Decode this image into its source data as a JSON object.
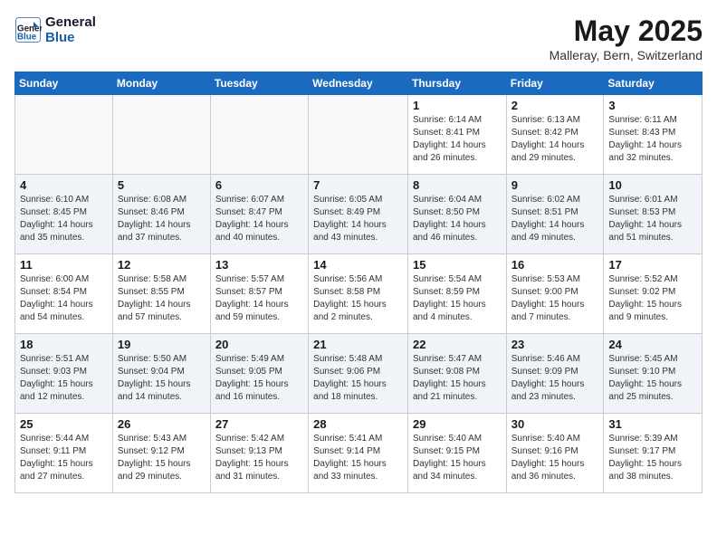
{
  "header": {
    "logo_line1": "General",
    "logo_line2": "Blue",
    "month": "May 2025",
    "location": "Malleray, Bern, Switzerland"
  },
  "weekdays": [
    "Sunday",
    "Monday",
    "Tuesday",
    "Wednesday",
    "Thursday",
    "Friday",
    "Saturday"
  ],
  "weeks": [
    [
      {
        "day": "",
        "info": ""
      },
      {
        "day": "",
        "info": ""
      },
      {
        "day": "",
        "info": ""
      },
      {
        "day": "",
        "info": ""
      },
      {
        "day": "1",
        "info": "Sunrise: 6:14 AM\nSunset: 8:41 PM\nDaylight: 14 hours\nand 26 minutes."
      },
      {
        "day": "2",
        "info": "Sunrise: 6:13 AM\nSunset: 8:42 PM\nDaylight: 14 hours\nand 29 minutes."
      },
      {
        "day": "3",
        "info": "Sunrise: 6:11 AM\nSunset: 8:43 PM\nDaylight: 14 hours\nand 32 minutes."
      }
    ],
    [
      {
        "day": "4",
        "info": "Sunrise: 6:10 AM\nSunset: 8:45 PM\nDaylight: 14 hours\nand 35 minutes."
      },
      {
        "day": "5",
        "info": "Sunrise: 6:08 AM\nSunset: 8:46 PM\nDaylight: 14 hours\nand 37 minutes."
      },
      {
        "day": "6",
        "info": "Sunrise: 6:07 AM\nSunset: 8:47 PM\nDaylight: 14 hours\nand 40 minutes."
      },
      {
        "day": "7",
        "info": "Sunrise: 6:05 AM\nSunset: 8:49 PM\nDaylight: 14 hours\nand 43 minutes."
      },
      {
        "day": "8",
        "info": "Sunrise: 6:04 AM\nSunset: 8:50 PM\nDaylight: 14 hours\nand 46 minutes."
      },
      {
        "day": "9",
        "info": "Sunrise: 6:02 AM\nSunset: 8:51 PM\nDaylight: 14 hours\nand 49 minutes."
      },
      {
        "day": "10",
        "info": "Sunrise: 6:01 AM\nSunset: 8:53 PM\nDaylight: 14 hours\nand 51 minutes."
      }
    ],
    [
      {
        "day": "11",
        "info": "Sunrise: 6:00 AM\nSunset: 8:54 PM\nDaylight: 14 hours\nand 54 minutes."
      },
      {
        "day": "12",
        "info": "Sunrise: 5:58 AM\nSunset: 8:55 PM\nDaylight: 14 hours\nand 57 minutes."
      },
      {
        "day": "13",
        "info": "Sunrise: 5:57 AM\nSunset: 8:57 PM\nDaylight: 14 hours\nand 59 minutes."
      },
      {
        "day": "14",
        "info": "Sunrise: 5:56 AM\nSunset: 8:58 PM\nDaylight: 15 hours\nand 2 minutes."
      },
      {
        "day": "15",
        "info": "Sunrise: 5:54 AM\nSunset: 8:59 PM\nDaylight: 15 hours\nand 4 minutes."
      },
      {
        "day": "16",
        "info": "Sunrise: 5:53 AM\nSunset: 9:00 PM\nDaylight: 15 hours\nand 7 minutes."
      },
      {
        "day": "17",
        "info": "Sunrise: 5:52 AM\nSunset: 9:02 PM\nDaylight: 15 hours\nand 9 minutes."
      }
    ],
    [
      {
        "day": "18",
        "info": "Sunrise: 5:51 AM\nSunset: 9:03 PM\nDaylight: 15 hours\nand 12 minutes."
      },
      {
        "day": "19",
        "info": "Sunrise: 5:50 AM\nSunset: 9:04 PM\nDaylight: 15 hours\nand 14 minutes."
      },
      {
        "day": "20",
        "info": "Sunrise: 5:49 AM\nSunset: 9:05 PM\nDaylight: 15 hours\nand 16 minutes."
      },
      {
        "day": "21",
        "info": "Sunrise: 5:48 AM\nSunset: 9:06 PM\nDaylight: 15 hours\nand 18 minutes."
      },
      {
        "day": "22",
        "info": "Sunrise: 5:47 AM\nSunset: 9:08 PM\nDaylight: 15 hours\nand 21 minutes."
      },
      {
        "day": "23",
        "info": "Sunrise: 5:46 AM\nSunset: 9:09 PM\nDaylight: 15 hours\nand 23 minutes."
      },
      {
        "day": "24",
        "info": "Sunrise: 5:45 AM\nSunset: 9:10 PM\nDaylight: 15 hours\nand 25 minutes."
      }
    ],
    [
      {
        "day": "25",
        "info": "Sunrise: 5:44 AM\nSunset: 9:11 PM\nDaylight: 15 hours\nand 27 minutes."
      },
      {
        "day": "26",
        "info": "Sunrise: 5:43 AM\nSunset: 9:12 PM\nDaylight: 15 hours\nand 29 minutes."
      },
      {
        "day": "27",
        "info": "Sunrise: 5:42 AM\nSunset: 9:13 PM\nDaylight: 15 hours\nand 31 minutes."
      },
      {
        "day": "28",
        "info": "Sunrise: 5:41 AM\nSunset: 9:14 PM\nDaylight: 15 hours\nand 33 minutes."
      },
      {
        "day": "29",
        "info": "Sunrise: 5:40 AM\nSunset: 9:15 PM\nDaylight: 15 hours\nand 34 minutes."
      },
      {
        "day": "30",
        "info": "Sunrise: 5:40 AM\nSunset: 9:16 PM\nDaylight: 15 hours\nand 36 minutes."
      },
      {
        "day": "31",
        "info": "Sunrise: 5:39 AM\nSunset: 9:17 PM\nDaylight: 15 hours\nand 38 minutes."
      }
    ]
  ]
}
